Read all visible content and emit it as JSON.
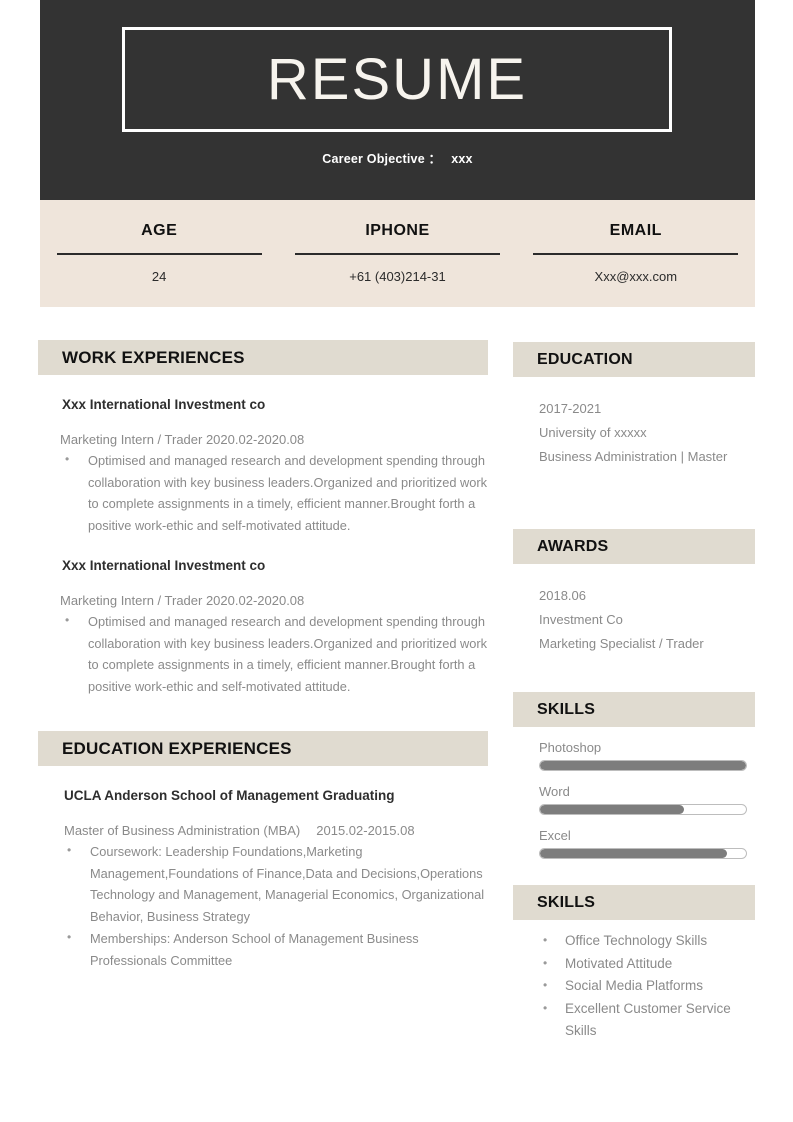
{
  "header": {
    "title": "RESUME",
    "objective_label": "Career Objective ：",
    "objective_value": "xxx"
  },
  "contact": {
    "items": [
      {
        "label": "AGE",
        "value": "24"
      },
      {
        "label": "IPHONE",
        "value": "+61 (403)214-31"
      },
      {
        "label": "EMAIL",
        "value": "Xxx@xxx.com"
      }
    ]
  },
  "work": {
    "heading": "WORK EXPERIENCES",
    "entries": [
      {
        "company": "Xxx International Investment co",
        "role": "Marketing Intern / Trader 2020.02-2020.08",
        "bullets": [
          "Optimised and managed research and development spending through collaboration with key business leaders.Organized and prioritized work to complete assignments in a timely, efficient manner.Brought forth a positive work-ethic and self-motivated attitude."
        ]
      },
      {
        "company": "Xxx International Investment co",
        "role": "Marketing Intern / Trader 2020.02-2020.08",
        "bullets": [
          "Optimised and managed research and development spending through collaboration with key business leaders.Organized and prioritized work to complete assignments in a timely, efficient manner.Brought forth a positive work-ethic and self-motivated attitude."
        ]
      }
    ]
  },
  "education_experiences": {
    "heading": "EDUCATION EXPERIENCES",
    "school": "UCLA Anderson School of Management Graduating",
    "degree": "Master of Business Administration (MBA)",
    "dates": "2015.02-2015.08",
    "bullets": [
      "Coursework: Leadership Foundations,Marketing Management,Foundations of Finance,Data and Decisions,Operations Technology and Management, Managerial Economics, Organizational Behavior, Business Strategy",
      "Memberships: Anderson School of Management Business Professionals Committee"
    ]
  },
  "education": {
    "heading": "EDUCATION",
    "lines": [
      "2017-2021",
      "University of xxxxx",
      "Business Administration | Master"
    ]
  },
  "awards": {
    "heading": "AWARDS",
    "lines": [
      "2018.06",
      "Investment Co",
      "Marketing Specialist / Trader"
    ]
  },
  "skills_bars": {
    "heading": "SKILLS",
    "items": [
      {
        "name": "Photoshop",
        "percent": 100
      },
      {
        "name": "Word",
        "percent": 70
      },
      {
        "name": "Excel",
        "percent": 91
      }
    ]
  },
  "skills_list": {
    "heading": "SKILLS",
    "items": [
      "Office Technology Skills",
      "Motivated Attitude",
      "Social Media Platforms",
      "Excellent Customer Service Skills"
    ]
  },
  "colors": {
    "header_bg": "#333333",
    "contact_bg": "#efe5db",
    "band_bg": "#e0dbd0",
    "body_text": "#8a8a8a",
    "heading_text": "#111111",
    "bar_fill": "#7d7d7d"
  }
}
